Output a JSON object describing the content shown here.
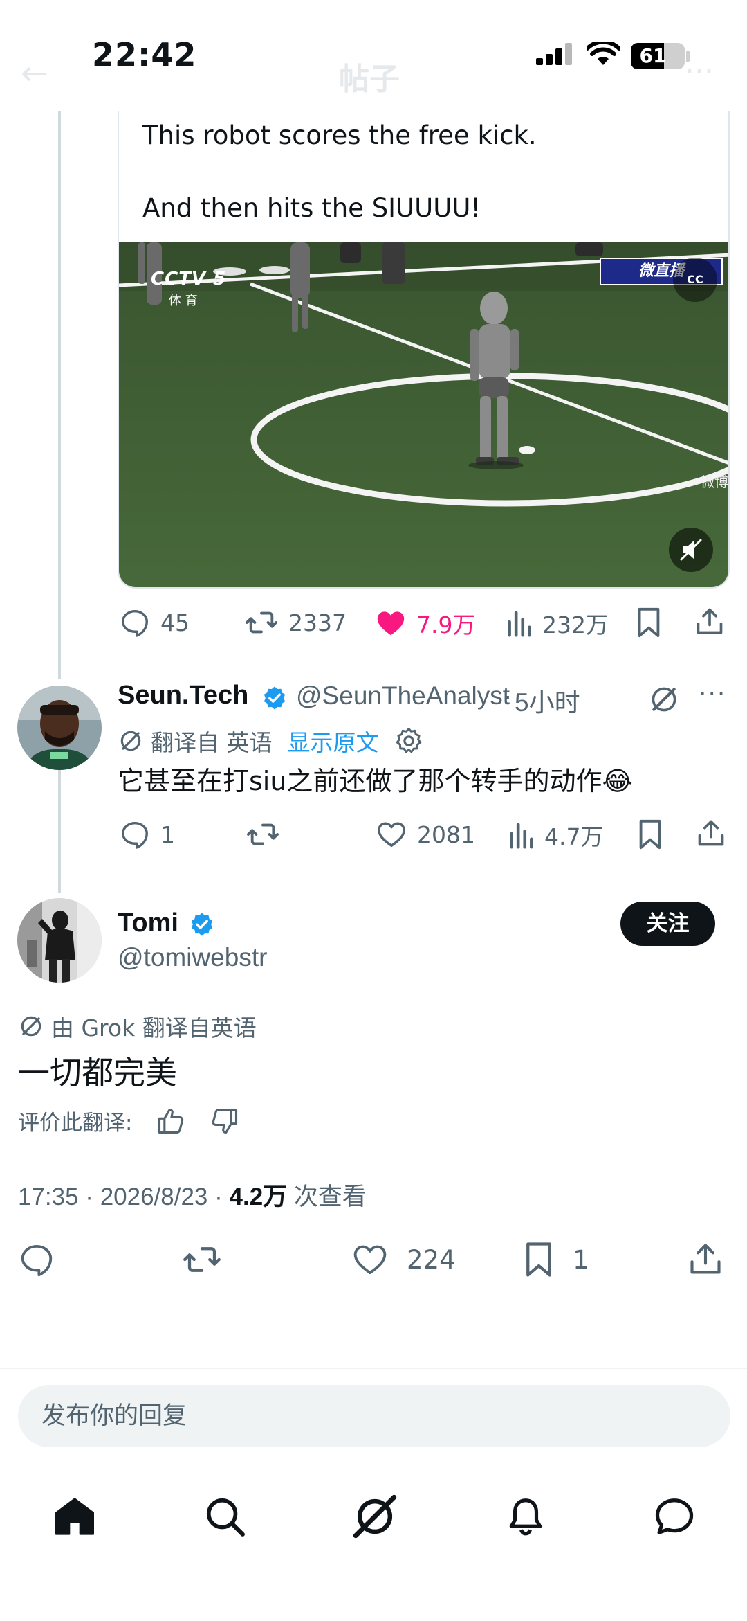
{
  "status_bar": {
    "time": "22:42",
    "battery": "61",
    "battery_level": 0.61
  },
  "ghost_header": {
    "back": "←",
    "title": "帖子",
    "more": "···"
  },
  "quoted_tweet": {
    "line1": "This robot scores the free kick.",
    "line2": "And then hits the SIUUUU!",
    "video": {
      "channel": "CCTV 5",
      "channel_sub": "体 育",
      "live_badge": "微直播",
      "cc_label": "CC",
      "watermark": "微博"
    },
    "actions": {
      "replies": "45",
      "reposts": "2337",
      "likes": "7.9万",
      "views": "232万"
    }
  },
  "reply": {
    "name": "Seun.Tech",
    "handle": "@SeunTheAnalyst",
    "time": "5小时",
    "translated_label": "翻译自 英语",
    "show_original": "显示原文",
    "text": "它甚至在打siu之前还做了那个转手的动作😂",
    "actions": {
      "replies": "1",
      "likes": "2081",
      "views": "4.7万"
    }
  },
  "main_tweet": {
    "name": "Tomi",
    "handle": "@tomiwebstr",
    "follow_label": "关注",
    "grok_label": "由 Grok 翻译自英语",
    "text": "一切都完美",
    "rate_label": "评价此翻译:",
    "timestamp": "17:35 · 2026/8/23 · ",
    "views_count": "4.2万",
    "views_suffix": " 次查看",
    "actions": {
      "likes": "224",
      "bookmarks": "1"
    }
  },
  "reply_box": {
    "placeholder": "发布你的回复"
  },
  "colors": {
    "accent": "#1d9bf0",
    "like": "#f91880",
    "muted": "#536471",
    "text": "#0f1419"
  },
  "icons": [
    "reply-icon",
    "repost-icon",
    "heart-icon",
    "views-icon",
    "bookmark-icon",
    "share-icon",
    "grok-icon",
    "settings-icon",
    "verified-icon",
    "home-icon",
    "search-icon",
    "notifications-icon",
    "messages-icon"
  ]
}
